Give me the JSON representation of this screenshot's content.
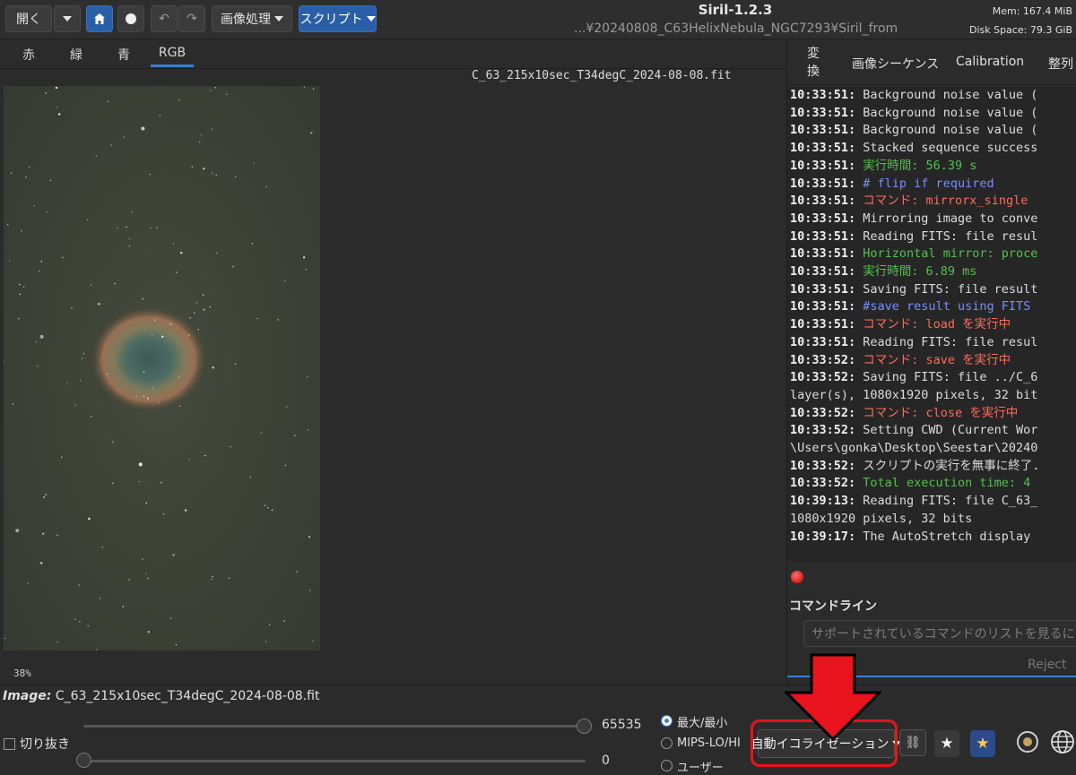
{
  "toolbar": {
    "open_label": "開く",
    "image_processing_label": "画像処理",
    "scripts_label": "スクリプト"
  },
  "window": {
    "title": "Siril-1.2.3",
    "path": "...¥20240808_C63HelixNebula_NGC7293¥Siril_from",
    "mem": "Mem: 167.4 MiB",
    "disk": "Disk Space: 79.3 GiB"
  },
  "channels": [
    "赤",
    "緑",
    "青",
    "RGB"
  ],
  "viewer": {
    "filename": "C_63_215x10sec_T34degC_2024-08-08.fit",
    "zoom": "38%"
  },
  "right_tabs": [
    "変換",
    "画像シーケンス",
    "Calibration",
    "整列"
  ],
  "log": [
    {
      "ts": "10:33:51:",
      "text": " Background noise value (",
      "kind": "normal"
    },
    {
      "ts": "10:33:51:",
      "text": " Background noise value (",
      "kind": "normal"
    },
    {
      "ts": "10:33:51:",
      "text": " Background noise value (",
      "kind": "normal"
    },
    {
      "ts": "10:33:51:",
      "text": " Stacked sequence success",
      "kind": "normal"
    },
    {
      "ts": "10:33:51:",
      "text": " 実行時間: 56.39 s",
      "kind": "green"
    },
    {
      "ts": "10:33:51:",
      "text": " # flip if required",
      "kind": "blue"
    },
    {
      "ts": "10:33:51:",
      "text": " コマンド: mirrorx_single",
      "kind": "red"
    },
    {
      "ts": "10:33:51:",
      "text": " Mirroring image to conve",
      "kind": "normal"
    },
    {
      "ts": "10:33:51:",
      "text": " Reading FITS: file resul",
      "kind": "normal"
    },
    {
      "ts": "10:33:51:",
      "text": " Horizontal mirror: proce",
      "kind": "green"
    },
    {
      "ts": "10:33:51:",
      "text": " 実行時間: 6.89 ms",
      "kind": "green"
    },
    {
      "ts": "10:33:51:",
      "text": " Saving FITS: file result",
      "kind": "normal"
    },
    {
      "ts": "10:33:51:",
      "text": " #save result using FITS",
      "kind": "blue"
    },
    {
      "ts": "10:33:51:",
      "text": " コマンド: load を実行中",
      "kind": "red"
    },
    {
      "ts": "10:33:51:",
      "text": " Reading FITS: file resul",
      "kind": "normal"
    },
    {
      "ts": "10:33:52:",
      "text": " コマンド: save を実行中",
      "kind": "red"
    },
    {
      "ts": "10:33:52:",
      "text": " Saving FITS: file ../C_6",
      "kind": "normal"
    },
    {
      "ts": "",
      "text": "layer(s), 1080x1920 pixels, 32 bit",
      "kind": "normal"
    },
    {
      "ts": "10:33:52:",
      "text": " コマンド: close を実行中",
      "kind": "red"
    },
    {
      "ts": "10:33:52:",
      "text": " Setting CWD (Current Wor",
      "kind": "normal"
    },
    {
      "ts": "",
      "text": "\\Users\\gonka\\Desktop\\Seestar\\20240",
      "kind": "normal"
    },
    {
      "ts": "10:33:52:",
      "text": " スクリプトの実行を無事に終了.",
      "kind": "normal"
    },
    {
      "ts": "10:33:52:",
      "text": " Total execution time: 4",
      "kind": "green"
    },
    {
      "ts": "10:39:13:",
      "text": " Reading FITS: file C_63_",
      "kind": "normal"
    },
    {
      "ts": "",
      "text": "1080x1920 pixels, 32 bits",
      "kind": "normal"
    },
    {
      "ts": "10:39:17:",
      "text": " The AutoStretch display",
      "kind": "normal"
    }
  ],
  "command_line": {
    "label": "コマンドライン",
    "placeholder": "サポートされているコマンドのリストを見るには ``hel",
    "reject": "Reject"
  },
  "bottom": {
    "image_prefix": "Image:",
    "image_name": "C_63_215x10sec_T34degC_2024-08-08.fit",
    "crop_label": "切り抜き",
    "slider_max_value": "65535",
    "slider_min_value": "0",
    "radio_minmax": "最大/最小",
    "radio_mips": "MIPS-LO/HI",
    "radio_user": "ユーザー",
    "display_mode": "自動イコライゼーション"
  },
  "colors": {
    "accent": "#2a5ea8",
    "highlight": "#e8131c",
    "log_green": "#53c04d",
    "log_blue": "#7a8dff",
    "log_red": "#ff6b5a"
  }
}
